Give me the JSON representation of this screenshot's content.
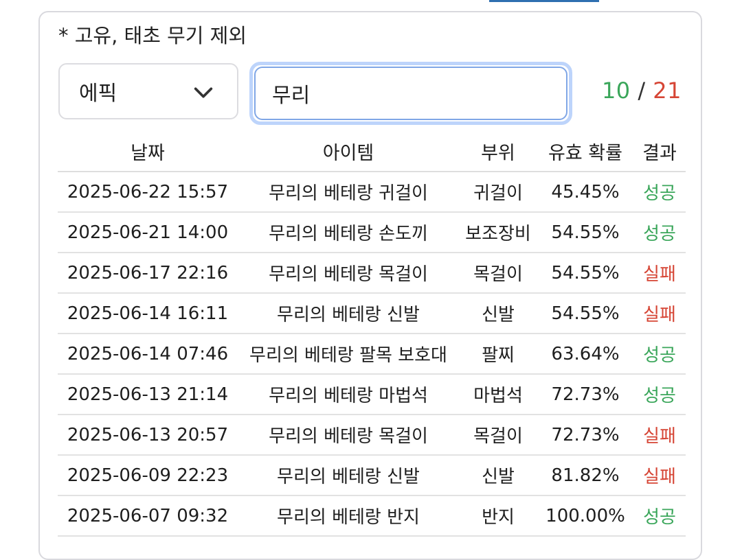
{
  "note": "* 고유, 태초 무기 제외",
  "filters": {
    "grade": "에픽",
    "search_value": "무리"
  },
  "counter": {
    "success": "10",
    "separator": "/",
    "total": "21"
  },
  "colors": {
    "success": "#3aa65a",
    "fail": "#d64535",
    "slot": "#f2ad1c",
    "focus_ring": "#bdd4fb"
  },
  "table": {
    "headers": [
      "날짜",
      "아이템",
      "부위",
      "유효 확률",
      "결과"
    ],
    "rows": [
      {
        "date": "2025-06-22 15:57",
        "item": "무리의 베테랑 귀걸이",
        "slot": "귀걸이",
        "prob": "45.45%",
        "result": "성공",
        "status": "success"
      },
      {
        "date": "2025-06-21 14:00",
        "item": "무리의 베테랑 손도끼",
        "slot": "보조장비",
        "prob": "54.55%",
        "result": "성공",
        "status": "success"
      },
      {
        "date": "2025-06-17 22:16",
        "item": "무리의 베테랑 목걸이",
        "slot": "목걸이",
        "prob": "54.55%",
        "result": "실패",
        "status": "fail"
      },
      {
        "date": "2025-06-14 16:11",
        "item": "무리의 베테랑 신발",
        "slot": "신발",
        "prob": "54.55%",
        "result": "실패",
        "status": "fail"
      },
      {
        "date": "2025-06-14 07:46",
        "item": "무리의 베테랑 팔목 보호대",
        "slot": "팔찌",
        "prob": "63.64%",
        "result": "성공",
        "status": "success"
      },
      {
        "date": "2025-06-13 21:14",
        "item": "무리의 베테랑 마법석",
        "slot": "마법석",
        "prob": "72.73%",
        "result": "성공",
        "status": "success"
      },
      {
        "date": "2025-06-13 20:57",
        "item": "무리의 베테랑 목걸이",
        "slot": "목걸이",
        "prob": "72.73%",
        "result": "실패",
        "status": "fail"
      },
      {
        "date": "2025-06-09 22:23",
        "item": "무리의 베테랑 신발",
        "slot": "신발",
        "prob": "81.82%",
        "result": "실패",
        "status": "fail"
      },
      {
        "date": "2025-06-07 09:32",
        "item": "무리의 베테랑 반지",
        "slot": "반지",
        "prob": "100.00%",
        "result": "성공",
        "status": "success"
      }
    ]
  }
}
